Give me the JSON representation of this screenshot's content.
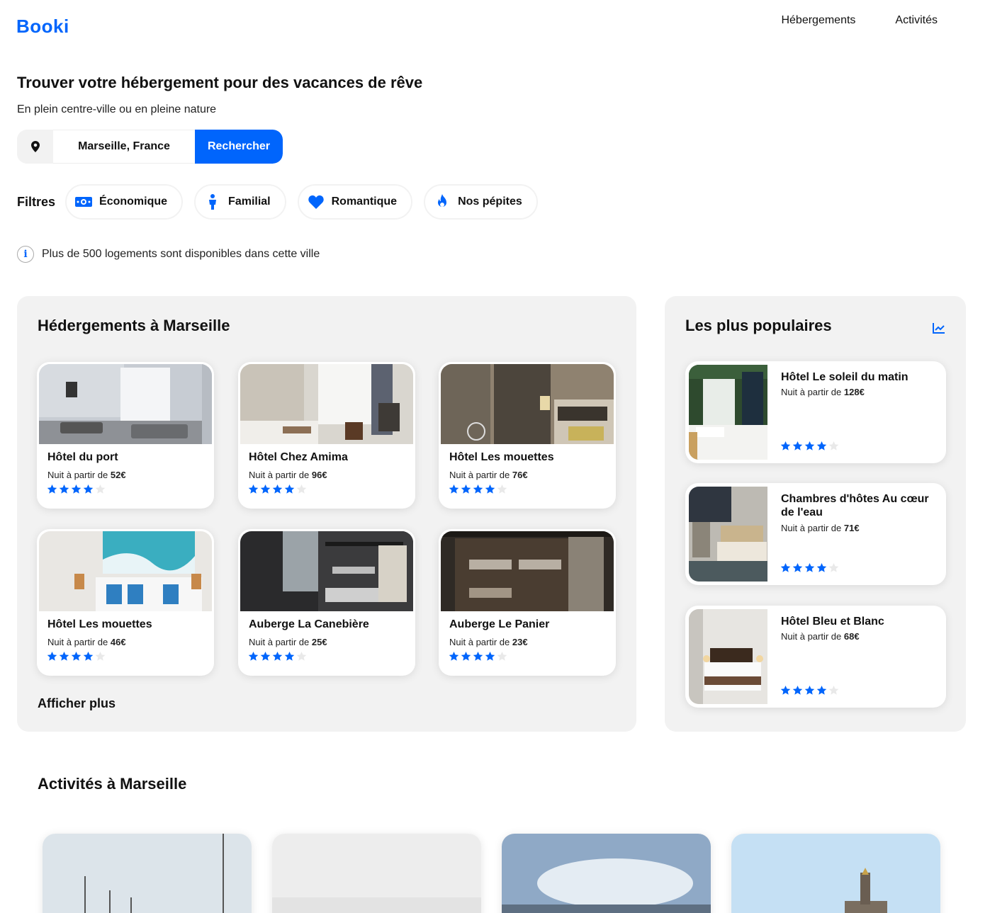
{
  "brand": {
    "logo": "Booki",
    "accent": "#0065FC",
    "panel_bg": "#F2F2F2"
  },
  "nav": {
    "items": [
      "Hébergements",
      "Activités"
    ]
  },
  "hero": {
    "title": "Trouver votre hébergement pour des vacances de rêve",
    "subtitle": "En plein centre-ville ou en pleine nature"
  },
  "search": {
    "pin_icon": "map-pin-icon",
    "value": "Marseille, France",
    "button": "Rechercher"
  },
  "filters": {
    "label": "Filtres",
    "items": [
      {
        "label": "Économique",
        "icon": "money-icon"
      },
      {
        "label": "Familial",
        "icon": "person-icon"
      },
      {
        "label": "Romantique",
        "icon": "heart-icon"
      },
      {
        "label": "Nos pépites",
        "icon": "fire-icon"
      }
    ]
  },
  "info": {
    "icon": "info-icon",
    "text": "Plus de 500 logements sont disponibles dans cette ville"
  },
  "lodgings": {
    "title": "Hédergements à Marseille",
    "price_prefix": "Nuit à partir de ",
    "cards": [
      {
        "name": "Hôtel du port",
        "price": "52€",
        "rating": 4
      },
      {
        "name": "Hôtel Chez Amima",
        "price": "96€",
        "rating": 4
      },
      {
        "name": "Hôtel Les mouettes",
        "price": "76€",
        "rating": 4
      },
      {
        "name": "Hôtel Les mouettes",
        "price": "46€",
        "rating": 4
      },
      {
        "name": "Auberge La Canebière",
        "price": "25€",
        "rating": 4
      },
      {
        "name": "Auberge Le Panier",
        "price": "23€",
        "rating": 4
      }
    ],
    "more": "Afficher plus"
  },
  "popular": {
    "title": "Les plus populaires",
    "trend_icon": "trend-chart-icon",
    "price_prefix": "Nuit à partir de ",
    "cards": [
      {
        "name": "Hôtel Le soleil du matin",
        "price": "128€",
        "rating": 4
      },
      {
        "name": "Chambres d'hôtes Au cœur de l'eau",
        "price": "71€",
        "rating": 4
      },
      {
        "name": "Hôtel Bleu et Blanc",
        "price": "68€",
        "rating": 4
      }
    ]
  },
  "activities": {
    "title": "Activités à Marseille"
  }
}
